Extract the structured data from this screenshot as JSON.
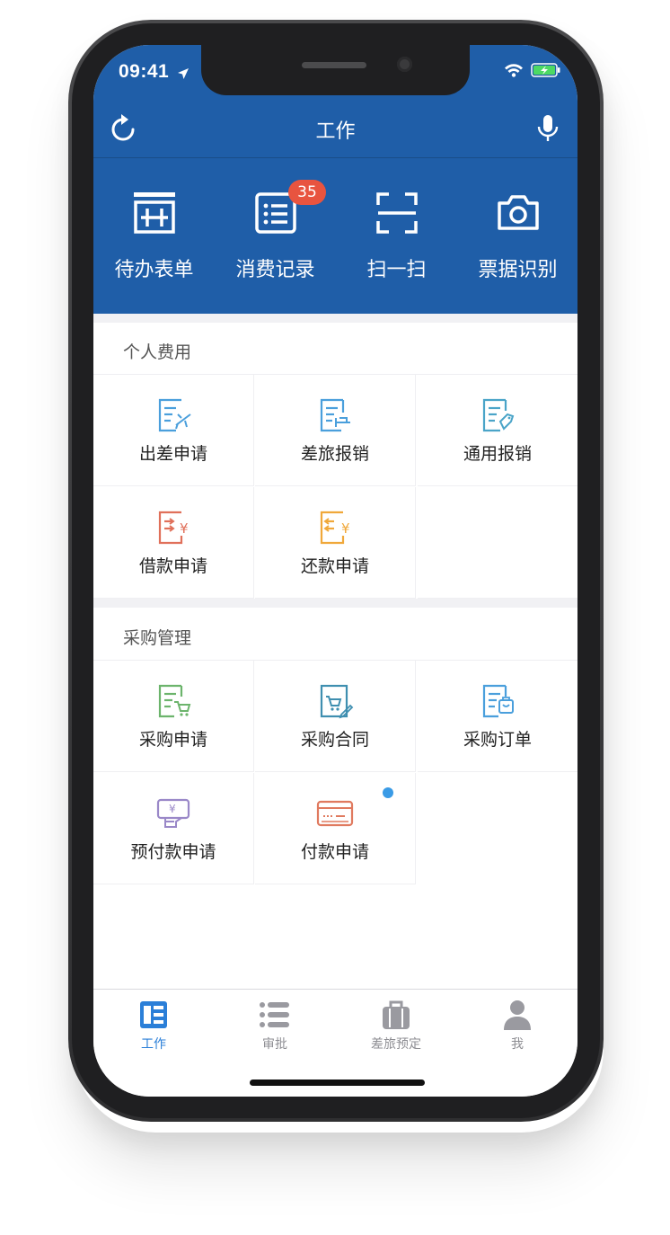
{
  "status": {
    "time": "09:41"
  },
  "header": {
    "title": "工作"
  },
  "quick_actions": [
    {
      "label": "待办表单",
      "icon": "form-icon"
    },
    {
      "label": "消费记录",
      "icon": "list-icon",
      "badge": "35"
    },
    {
      "label": "扫一扫",
      "icon": "scan-icon"
    },
    {
      "label": "票据识别",
      "icon": "camera-icon"
    }
  ],
  "sections": {
    "personal": {
      "title": "个人费用",
      "items": [
        {
          "label": "出差申请",
          "icon": "travel-request-icon"
        },
        {
          "label": "差旅报销",
          "icon": "travel-reimburse-icon"
        },
        {
          "label": "通用报销",
          "icon": "general-reimburse-icon"
        },
        {
          "label": "借款申请",
          "icon": "loan-request-icon"
        },
        {
          "label": "还款申请",
          "icon": "repay-request-icon"
        }
      ]
    },
    "purchase": {
      "title": "采购管理",
      "items": [
        {
          "label": "采购申请",
          "icon": "purchase-request-icon"
        },
        {
          "label": "采购合同",
          "icon": "purchase-contract-icon"
        },
        {
          "label": "采购订单",
          "icon": "purchase-order-icon"
        },
        {
          "label": "预付款申请",
          "icon": "prepayment-request-icon"
        },
        {
          "label": "付款申请",
          "icon": "payment-request-icon"
        }
      ]
    }
  },
  "tabbar": [
    {
      "label": "工作",
      "active": true
    },
    {
      "label": "审批"
    },
    {
      "label": "差旅预定"
    },
    {
      "label": "我"
    }
  ],
  "colors": {
    "brand_blue": "#1f5ea8",
    "badge_red": "#e8543f",
    "active_tab": "#2b7fd8"
  }
}
